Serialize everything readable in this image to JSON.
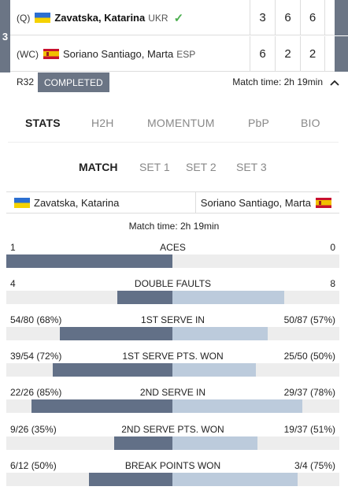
{
  "match": {
    "round_tab": "3",
    "players": [
      {
        "seed": "(Q)",
        "flag": "ukr",
        "name": "Zavatska, Katarina",
        "country": "UKR",
        "winner": true,
        "sets": [
          "3",
          "6",
          "6"
        ]
      },
      {
        "seed": "(WC)",
        "flag": "esp",
        "name": "Soriano Santiago, Marta",
        "country": "ESP",
        "winner": false,
        "sets": [
          "6",
          "2",
          "2"
        ]
      }
    ],
    "round_code": "R32",
    "status": "COMPLETED",
    "match_time": "Match time: 2h 19min"
  },
  "tabs": [
    "STATS",
    "H2H",
    "MOMENTUM",
    "PbP",
    "BIO"
  ],
  "active_tab": "STATS",
  "sub_tabs": [
    "MATCH",
    "SET 1",
    "SET 2",
    "SET 3"
  ],
  "active_sub_tab": "MATCH",
  "header": {
    "left_player": "Zavatska, Katarina",
    "right_player": "Soriano Santiago, Marta",
    "match_time": "Match time: 2h 19min"
  },
  "stats": [
    {
      "label": "ACES",
      "left": "1",
      "right": "0",
      "left_share": 1.0,
      "right_share": 0.0
    },
    {
      "label": "DOUBLE FAULTS",
      "left": "4",
      "right": "8",
      "left_share": 0.33,
      "right_share": 0.67
    },
    {
      "label": "1ST SERVE IN",
      "left": "54/80 (68%)",
      "right": "50/87 (57%)",
      "left_share": 0.68,
      "right_share": 0.57
    },
    {
      "label": "1ST SERVE PTS. WON",
      "left": "39/54 (72%)",
      "right": "25/50 (50%)",
      "left_share": 0.72,
      "right_share": 0.5
    },
    {
      "label": "2ND SERVE IN",
      "left": "22/26 (85%)",
      "right": "29/37 (78%)",
      "left_share": 0.85,
      "right_share": 0.78
    },
    {
      "label": "2ND SERVE PTS. WON",
      "left": "9/26 (35%)",
      "right": "19/37 (51%)",
      "left_share": 0.35,
      "right_share": 0.51
    },
    {
      "label": "BREAK POINTS WON",
      "left": "6/12 (50%)",
      "right": "3/4 (75%)",
      "left_share": 0.5,
      "right_share": 0.75
    }
  ],
  "colors": {
    "left_bar": "#627087",
    "right_bar": "#bccbdc",
    "track": "#ededed",
    "badge": "#6b7585",
    "check": "#4caf50"
  },
  "icons": {
    "winner": "checkmark-icon",
    "collapse": "chevron-up-icon"
  }
}
